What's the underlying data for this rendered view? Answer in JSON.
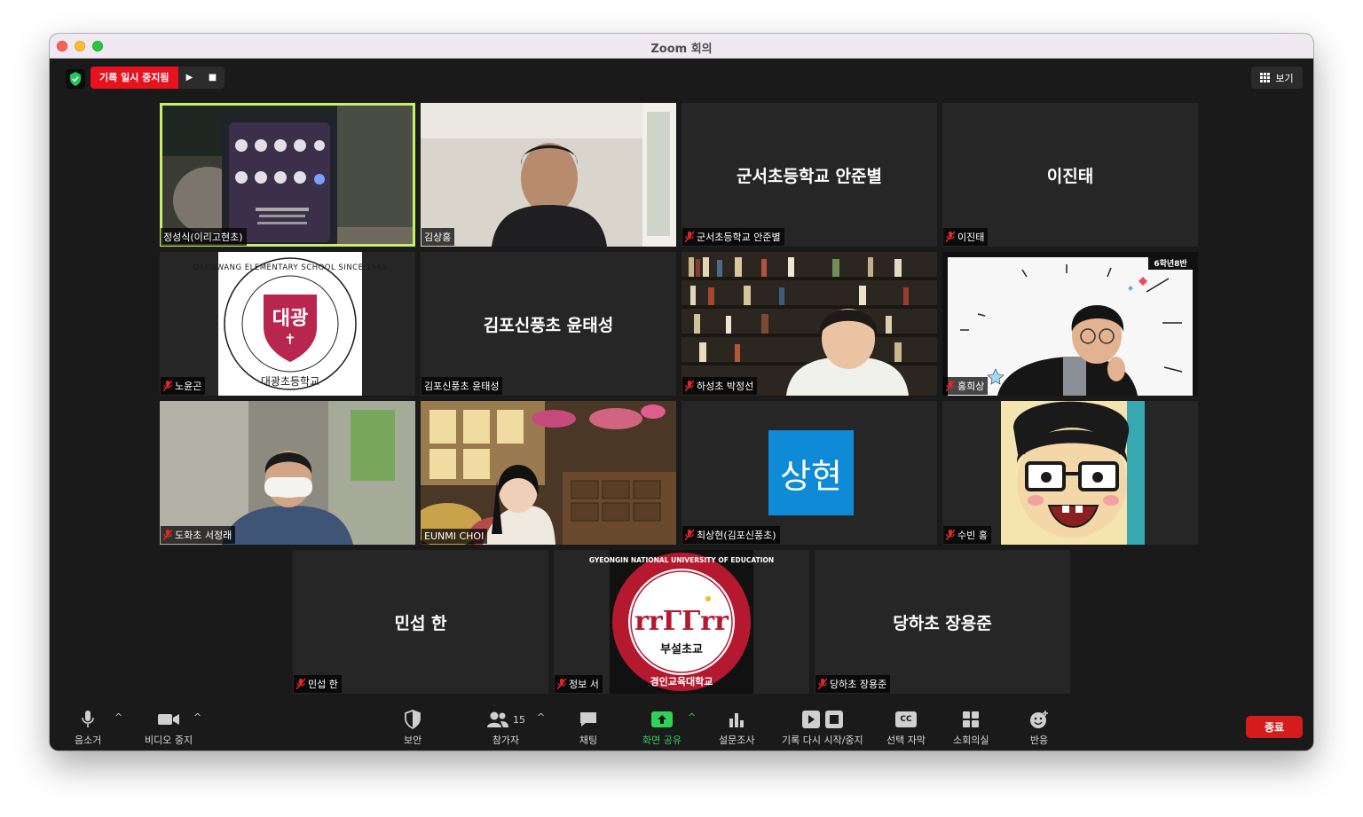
{
  "window": {
    "title": "Zoom 회의"
  },
  "top_bar": {
    "recording_label": "기록 일시 중지됨",
    "play_glyph": "▶",
    "stop_glyph": "■",
    "view_label": "보기"
  },
  "tiles": {
    "t1": {
      "name": "정성식(이리고현초)",
      "muted": false,
      "active": true
    },
    "t2": {
      "name": "김상홍",
      "muted": false
    },
    "t3": {
      "name": "군서초등학교 안준별",
      "display": "군서초등학교 안준별",
      "muted": true
    },
    "t4": {
      "name": "이진태",
      "display": "이진태",
      "muted": true
    },
    "t5": {
      "name": "노윤곤",
      "muted": true,
      "logo_text": "대광",
      "logo_ring": "DAEGWANG ELEMENTARY SCHOOL SINCE 1965",
      "logo_bottom": "대광초등학교"
    },
    "t6": {
      "name": "김포신풍초 윤태성",
      "display": "김포신풍초 윤태성",
      "muted": false
    },
    "t7": {
      "name": "하성초 박정선",
      "muted": true
    },
    "t8": {
      "name": "홍희상",
      "muted": true,
      "banner": "6학년8반"
    },
    "t9": {
      "name": "도화초 서정래",
      "muted": true
    },
    "t10": {
      "name": "EUNMI CHOI",
      "muted": false
    },
    "t11": {
      "name": "최상현(김포신풍초)",
      "muted": true,
      "avatar_text": "상현",
      "avatar_color": "#0e8ad6"
    },
    "t12": {
      "name": "수빈 홍",
      "muted": true
    },
    "t13": {
      "name": "민섭 한",
      "display": "민섭 한",
      "muted": true
    },
    "t14": {
      "name": "정보 서",
      "muted": true,
      "logo_ring": "GYEONGIN NATIONAL UNIVERSITY OF EDUCATION",
      "logo_mid": "부설초교",
      "logo_bottom": "경인교육대학교"
    },
    "t15": {
      "name": "당하초 장용준",
      "display": "당하초 장용준",
      "muted": true
    }
  },
  "toolbar": {
    "mute": "음소거",
    "video": "비디오 중지",
    "security": "보안",
    "participants": "참가자",
    "participants_count": "15",
    "chat": "채팅",
    "share": "화면 공유",
    "polls": "설문조사",
    "record": "기록 다시 시작/중지",
    "captions": "선택 자막",
    "captions_badge": "CC",
    "breakout": "소회의실",
    "reactions": "반응",
    "end": "종료"
  },
  "colors": {
    "accent_red": "#e8121e",
    "share_green": "#30d158",
    "active_speaker": "#c6f06a",
    "end_button": "#d51c1c"
  }
}
